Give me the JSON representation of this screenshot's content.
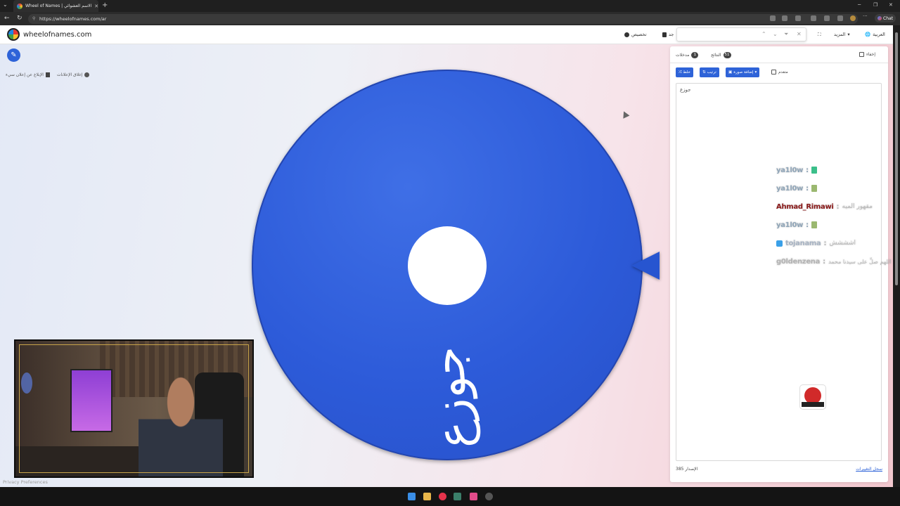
{
  "browser": {
    "tab_title": "Wheel of Names | الاسم العشوائي",
    "url": "https://wheelofnames.com/ar",
    "chat_label": "Chat"
  },
  "nav": {
    "brand": "wheelofnames.com",
    "customize": "تخصيص",
    "new": "جد",
    "more": "المزيد",
    "language": "العربية"
  },
  "ads": {
    "hide_ads": "إغلاق الإعلانات",
    "report_ad": "الإبلاغ عن إعلان سيء"
  },
  "wheel": {
    "segment_label": "جوزع",
    "color": "#2d5bd9"
  },
  "panel": {
    "tabs": [
      {
        "label": "مدخلات",
        "count": "1"
      },
      {
        "label": "النتائج",
        "count": "51"
      }
    ],
    "hide_label": "إخفاء",
    "buttons": {
      "shuffle": "خلط",
      "sort": "ترتيب",
      "add_image": "إضافة صورة"
    },
    "advanced_label": "متقدم",
    "entries": [
      "جوزع"
    ],
    "footer_count_label": "الإصدار",
    "footer_count": "385",
    "history_link": "سجل التغييرات"
  },
  "chat": [
    {
      "user": "ya1l0w",
      "color": "#8fa5b8",
      "message": ""
    },
    {
      "user": "ya1l0w",
      "color": "#8fa5b8",
      "message": ""
    },
    {
      "user": "Ahmad_Rimawi",
      "color": "#8b1a1a",
      "message": "مقهور الميه"
    },
    {
      "user": "ya1l0w",
      "color": "#8fa5b8",
      "message": ""
    },
    {
      "user": "tojanama",
      "color": "#a8b4c4",
      "message": "اشششش"
    },
    {
      "user": "g0ldenzena",
      "color": "#b4b4b4",
      "message": "اللهم صلِّ على سيدنا محمد"
    }
  ],
  "footer": {
    "privacy": "Privacy Preferences"
  }
}
